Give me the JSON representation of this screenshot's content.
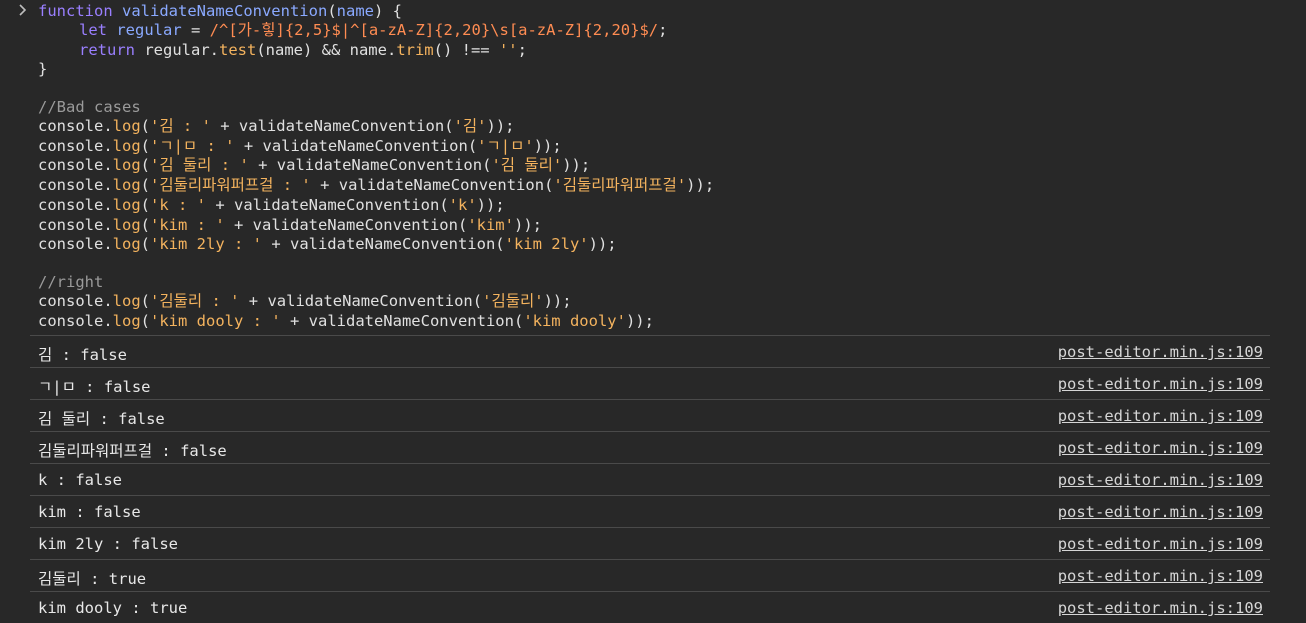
{
  "code": {
    "line1": {
      "keyword": "function",
      "name": "validateNameConvention",
      "open": "(",
      "param": "name",
      "close": ") {"
    },
    "line2": {
      "keyword": "let",
      "var": "regular",
      "eq": " = ",
      "regex": "/^[가-힣]{2,5}$|^[a-zA-Z]{2,20}\\s[a-zA-Z]{2,20}$/",
      "semi": ";"
    },
    "line3": {
      "keyword": "return",
      "obj": "regular.",
      "method": "test",
      "args": "(name) && name.",
      "method2": "trim",
      "rest": "() !== ",
      "str": "''",
      "semi": ";"
    },
    "line4": "}",
    "bad_comment": "//Bad cases",
    "bad_cases": [
      {
        "label": "'김 : '",
        "arg": "'김'"
      },
      {
        "label": "'ㄱ|ㅁ : '",
        "arg": "'ㄱ|ㅁ'"
      },
      {
        "label": "'김 둘리 : '",
        "arg": "'김 둘리'"
      },
      {
        "label": "'김둘리파워퍼프걸 : '",
        "arg": "'김둘리파워퍼프걸'"
      },
      {
        "label": "'k : '",
        "arg": "'k'"
      },
      {
        "label": "'kim : '",
        "arg": "'kim'"
      },
      {
        "label": "'kim 2ly : '",
        "arg": "'kim 2ly'"
      }
    ],
    "right_comment": "//right",
    "right_cases": [
      {
        "label": "'김둘리 : '",
        "arg": "'김둘리'"
      },
      {
        "label": "'kim dooly : '",
        "arg": "'kim dooly'"
      }
    ],
    "console": "console.",
    "log": "log",
    "fn": "validateNameConvention"
  },
  "outputs": [
    {
      "text": "김 : false",
      "source": "post-editor.min.js:109"
    },
    {
      "text": "ㄱ|ㅁ : false",
      "source": "post-editor.min.js:109"
    },
    {
      "text": "김 둘리 : false",
      "source": "post-editor.min.js:109"
    },
    {
      "text": "김둘리파워퍼프걸 : false",
      "source": "post-editor.min.js:109"
    },
    {
      "text": "k : false",
      "source": "post-editor.min.js:109"
    },
    {
      "text": "kim : false",
      "source": "post-editor.min.js:109"
    },
    {
      "text": "kim 2ly : false",
      "source": "post-editor.min.js:109"
    },
    {
      "text": "김둘리 : true",
      "source": "post-editor.min.js:109"
    },
    {
      "text": "kim dooly : true",
      "source": "post-editor.min.js:109"
    }
  ]
}
